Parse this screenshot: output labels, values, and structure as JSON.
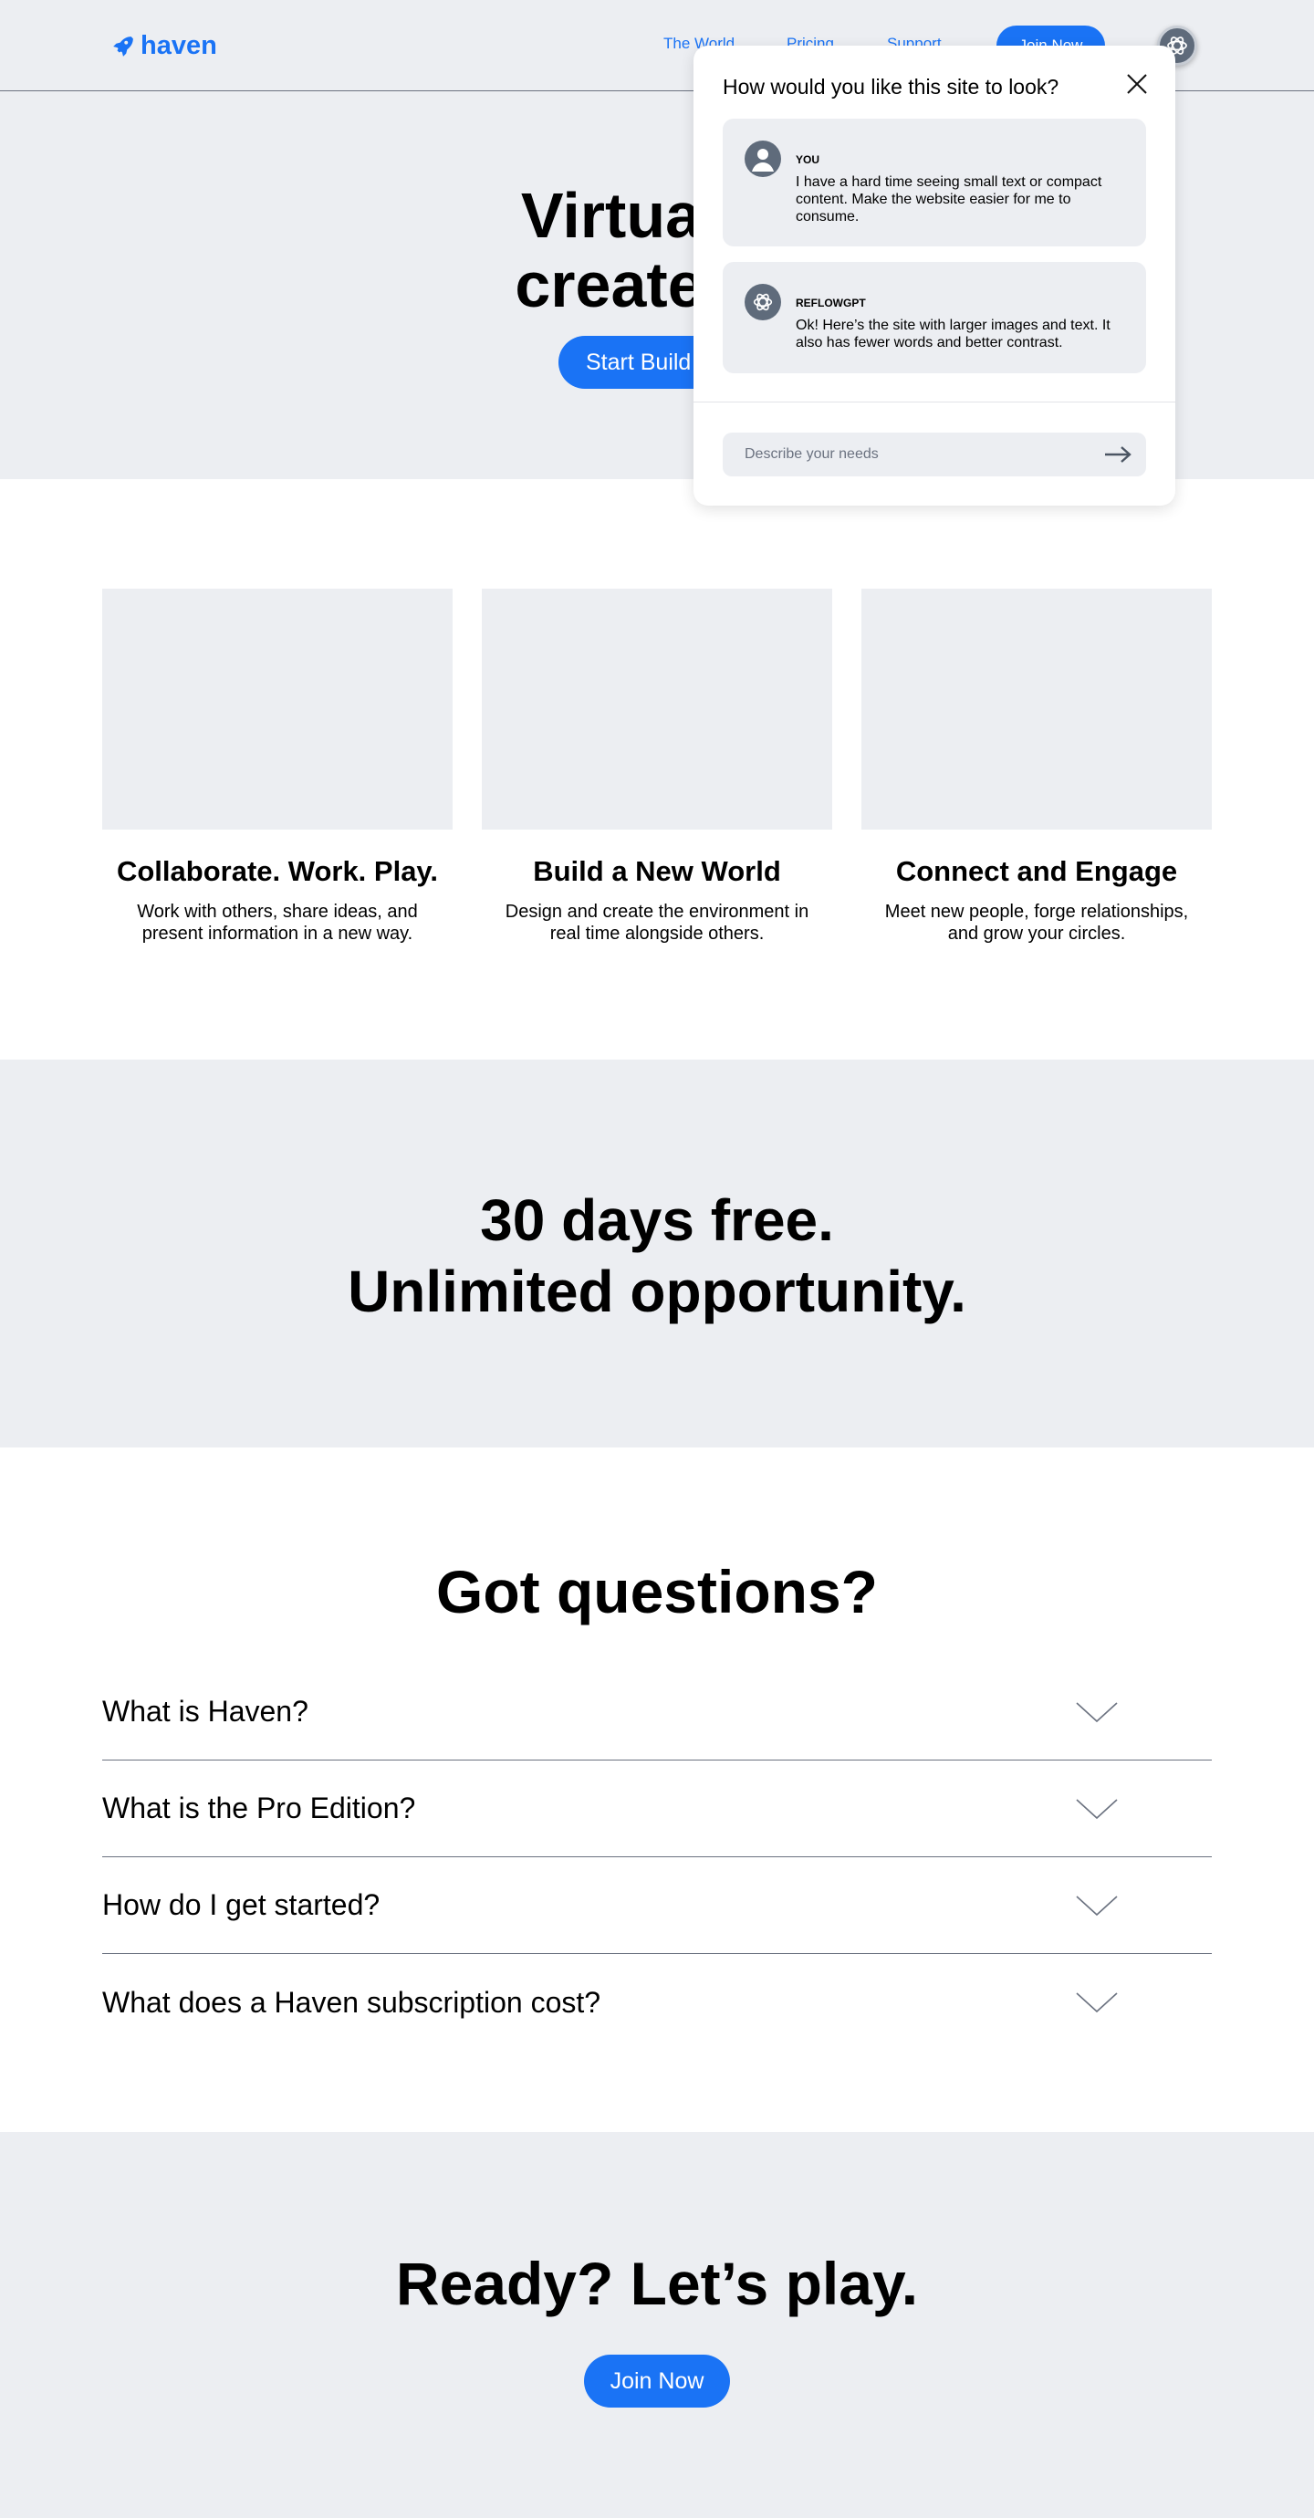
{
  "header": {
    "logo_text": "haven",
    "nav": [
      "The World",
      "Pricing",
      "Support"
    ],
    "join_label": "Join Now"
  },
  "hero": {
    "title_line1": "Virtual in",
    "title_line2": "created b",
    "cta_label": "Start Build"
  },
  "features": [
    {
      "title": "Collaborate. Work. Play.",
      "text": "Work with others, share ideas, and present information in a new way."
    },
    {
      "title": "Build a New World",
      "text": "Design and create the environment in real time alongside others."
    },
    {
      "title": "Connect and Engage",
      "text": "Meet new people, forge relationships, and grow your circles."
    }
  ],
  "promo": {
    "line1": "30 days free.",
    "line2": "Unlimited opportunity."
  },
  "faq": {
    "title": "Got questions?",
    "items": [
      "What is Haven?",
      "What is the Pro Edition?",
      "How do I get started?",
      "What does a Haven subscription cost?"
    ]
  },
  "cta": {
    "title": "Ready? Let’s play.",
    "button_label": "Join Now"
  },
  "chat": {
    "title": "How would you like this site to look?",
    "messages": [
      {
        "author": "YOU",
        "text": "I have a hard time seeing small text or compact content. Make the website easier for me to consume."
      },
      {
        "author": "REFLOWGPT",
        "text": "Ok! Here’s the site with larger images and text. It also has fewer words and better contrast."
      }
    ],
    "input_placeholder": "Describe your needs"
  },
  "colors": {
    "brand_blue": "#1a73f5",
    "surface_gray": "#eceef2",
    "avatar_slate": "#5f6b7b"
  },
  "icons": [
    "rocket-icon",
    "ai-knot-icon",
    "user-icon",
    "close-icon",
    "arrow-right-icon",
    "chevron-down-icon"
  ]
}
